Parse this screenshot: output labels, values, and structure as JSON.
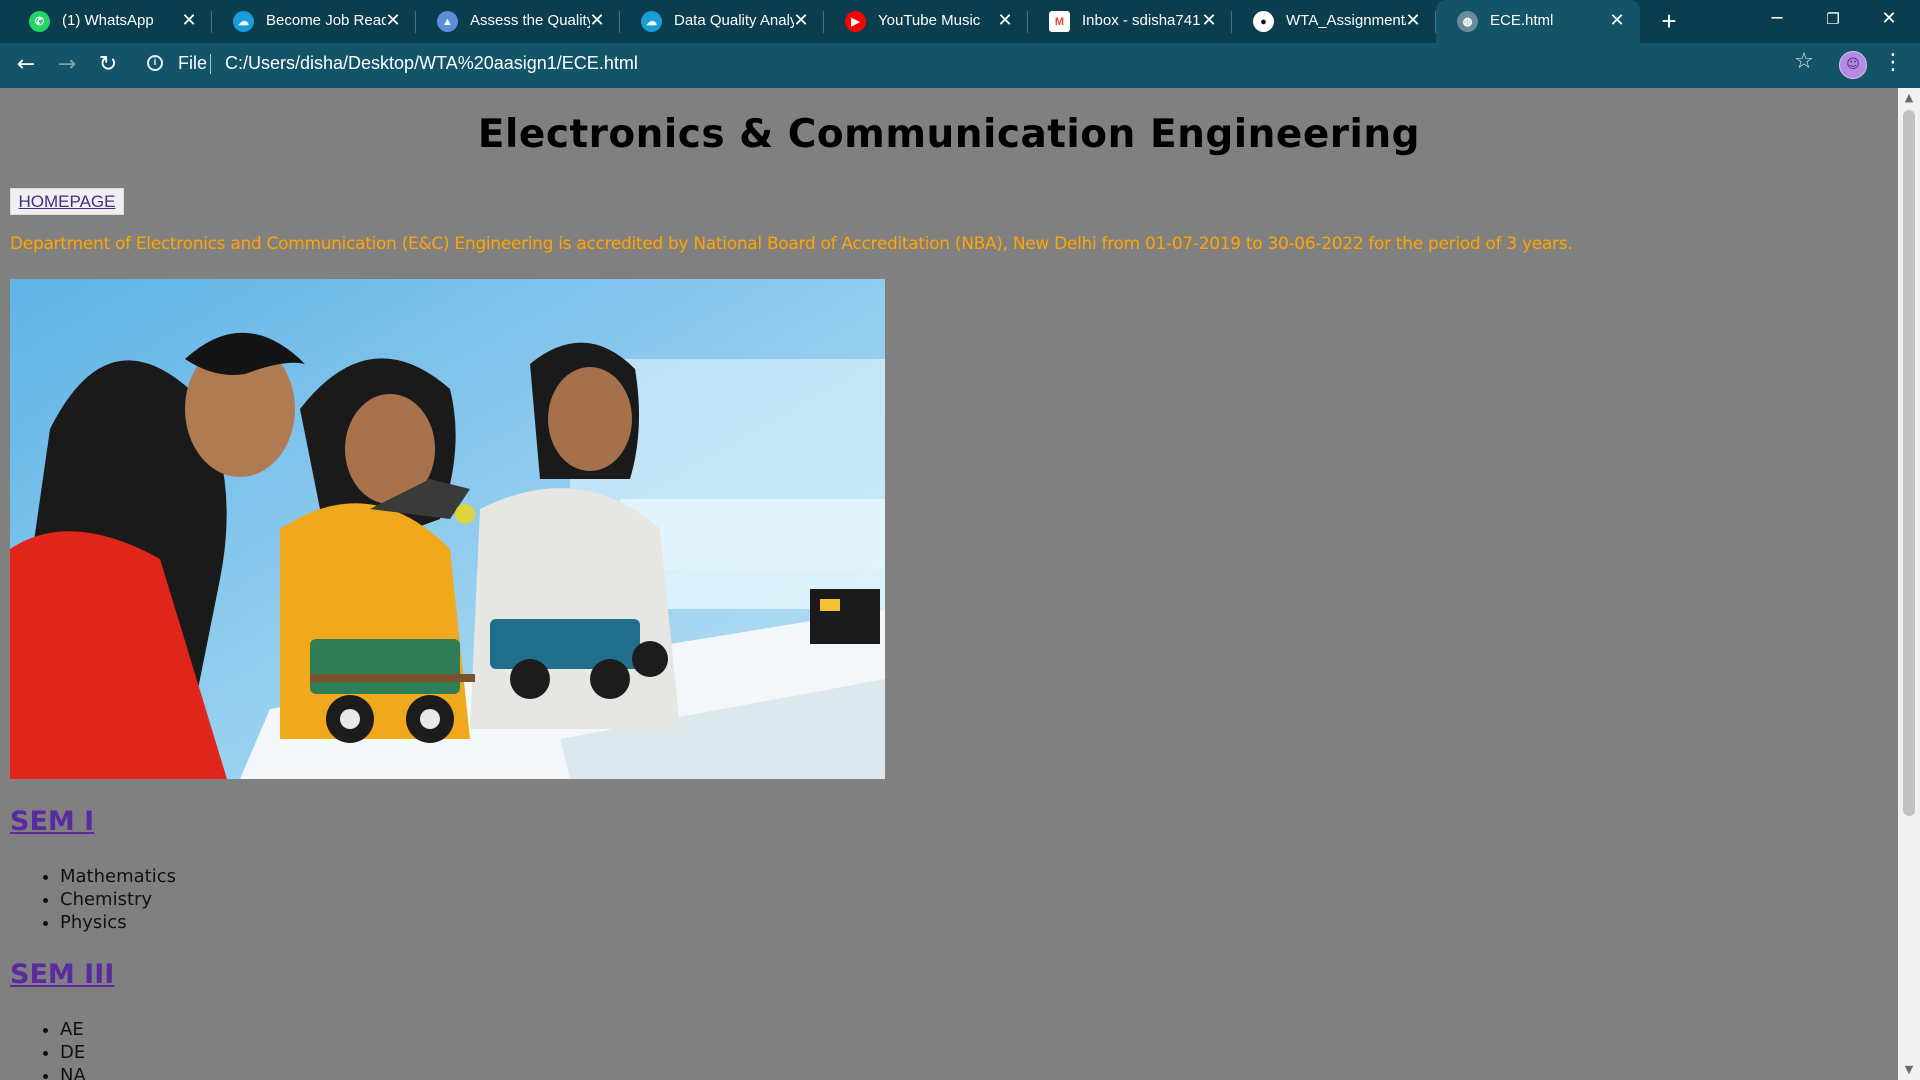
{
  "browser": {
    "tabs": [
      {
        "title": "(1) WhatsApp",
        "icon": "whatsapp-icon",
        "color": "#25d366",
        "glyph": "✆"
      },
      {
        "title": "Become Job Ready",
        "icon": "cloud-icon",
        "color": "#1b9ed8",
        "glyph": "☁"
      },
      {
        "title": "Assess the Quality",
        "icon": "drive-icon",
        "color": "#5b8fd8",
        "glyph": "▲"
      },
      {
        "title": "Data Quality Analy",
        "icon": "cloud-icon",
        "color": "#1b9ed8",
        "glyph": "☁"
      },
      {
        "title": "YouTube Music",
        "icon": "youtube-music-icon",
        "color": "#ff0000",
        "glyph": "▶"
      },
      {
        "title": "Inbox - sdisha741",
        "icon": "gmail-icon",
        "color": "#ea4335",
        "glyph": "M"
      },
      {
        "title": "WTA_Assignment/",
        "icon": "github-icon",
        "color": "#111111",
        "glyph": "●"
      },
      {
        "title": "ECE.html",
        "icon": "globe-icon",
        "color": "#6a8e99",
        "glyph": "◍"
      }
    ],
    "address": {
      "scheme_label": "File",
      "url": "C:/Users/disha/Desktop/WTA%20aasign1/ECE.html"
    }
  },
  "page": {
    "title": "Electronics & Communication Engineering",
    "home_link": "HOMEPAGE",
    "accreditation": "Department of Electronics and Communication (E&C) Engineering is accredited by National Board of Accreditation (NBA), New Delhi from 01-07-2019 to 30-06-2022 for the period of 3 years.",
    "semesters": [
      {
        "heading": "SEM I",
        "subjects": [
          "Mathematics",
          "Chemistry",
          "Physics"
        ]
      },
      {
        "heading": "SEM III",
        "subjects": [
          "AE",
          "DE",
          "NA"
        ]
      }
    ]
  },
  "colors": {
    "accent_orange": "#ffa500",
    "link_purple": "#5b2aa0",
    "page_background": "#808080",
    "chrome_dark": "#0a3d4d",
    "chrome_toolbar": "#135468"
  }
}
